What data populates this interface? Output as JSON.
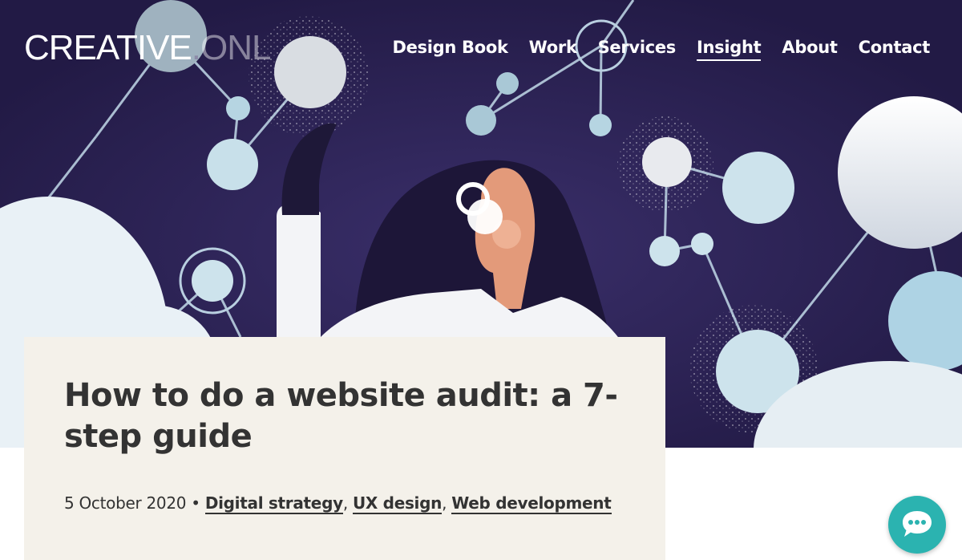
{
  "brand": {
    "logo_main": "CREATIVE",
    "logo_dot": ".",
    "logo_suffix": "ONL"
  },
  "nav": {
    "items": [
      {
        "label": "Design Book",
        "active": false
      },
      {
        "label": "Work",
        "active": false
      },
      {
        "label": "Services",
        "active": false
      },
      {
        "label": "Insight",
        "active": true
      },
      {
        "label": "About",
        "active": false
      },
      {
        "label": "Contact",
        "active": false
      }
    ]
  },
  "article": {
    "title": "How to do a website audit: a 7-step guide",
    "date": "5 October 2020",
    "separator": " • ",
    "categories": [
      "Digital strategy",
      "UX design",
      "Web development"
    ]
  },
  "colors": {
    "hero_bg": "#2a2150",
    "card_bg": "#f4f1ea",
    "text": "#333333",
    "chat_button": "#2bb3b0",
    "node_light": "#cde3ec"
  },
  "icons": {
    "chat": "chat-bubble-icon"
  }
}
